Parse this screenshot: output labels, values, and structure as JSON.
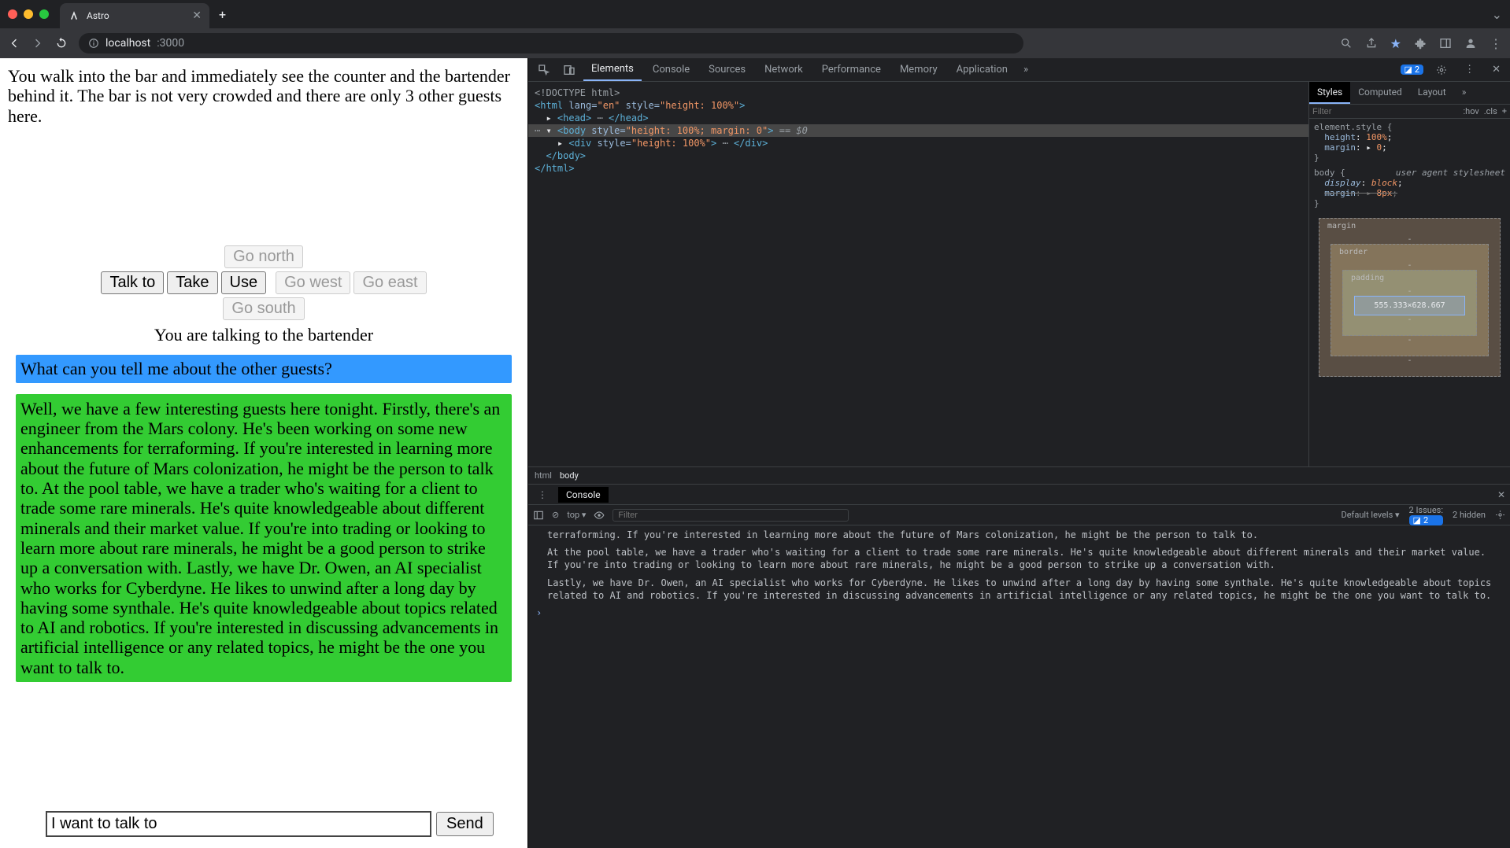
{
  "browser": {
    "tab_title": "Astro",
    "url_host": "localhost",
    "url_port": ":3000"
  },
  "game": {
    "description": "You walk into the bar and immediately see the counter and the bartender behind it. The bar is not very crowded and there are only 3 other guests here.",
    "buttons": {
      "talk": "Talk to",
      "take": "Take",
      "use": "Use",
      "north": "Go north",
      "south": "Go south",
      "east": "Go east",
      "west": "Go west"
    },
    "status": "You are talking to the bartender",
    "user_msg": "What can you tell me about the other guests?",
    "npc_msg": "Well, we have a few interesting guests here tonight. Firstly, there's an engineer from the Mars colony. He's been working on some new enhancements for terraforming. If you're interested in learning more about the future of Mars colonization, he might be the person to talk to. At the pool table, we have a trader who's waiting for a client to trade some rare minerals. He's quite knowledgeable about different minerals and their market value. If you're into trading or looking to learn more about rare minerals, he might be a good person to strike up a conversation with. Lastly, we have Dr. Owen, an AI specialist who works for Cyberdyne. He likes to unwind after a long day by having some synthale. He's quite knowledgeable about topics related to AI and robotics. If you're interested in discussing advancements in artificial intelligence or any related topics, he might be the one you want to talk to.",
    "input_value": "I want to talk to ",
    "send_label": "Send"
  },
  "devtools": {
    "tabs": [
      "Elements",
      "Console",
      "Sources",
      "Network",
      "Performance",
      "Memory",
      "Application"
    ],
    "active_tab": "Elements",
    "issues_count": "2",
    "dom": {
      "l1": "<!DOCTYPE html>",
      "l2a": "<",
      "l2b": "html",
      "l2c": " lang=",
      "l2d": "\"en\"",
      "l2e": " style=",
      "l2f": "\"height: 100%\"",
      "l2g": ">",
      "l3": "<head>",
      "l3b": "</head>",
      "l4a": "<",
      "l4b": "body",
      "l4c": " style=",
      "l4d": "\"height: 100%; margin: 0\"",
      "l4e": ">",
      "l4f": " == $0",
      "l5a": "<",
      "l5b": "div",
      "l5c": " style=",
      "l5d": "\"height: 100%\"",
      "l5e": ">",
      "l5f": "</div>",
      "l6": "</body>",
      "l7": "</html>"
    },
    "styles": {
      "tabs": [
        "Styles",
        "Computed",
        "Layout"
      ],
      "filter_placeholder": "Filter",
      "hov": ":hov",
      "cls": ".cls",
      "rule1_sel": "element.style {",
      "rule1_p1": "height",
      "rule1_v1": "100%",
      "rule1_p2": "margin",
      "rule1_v2": "0",
      "rule2_sel": "body {",
      "rule2_comment": "user agent stylesheet",
      "rule2_p1": "display",
      "rule2_v1": "block",
      "rule2_p2": "margin",
      "rule2_v2": "8px",
      "close": "}",
      "box_margin": "margin",
      "box_border": "border",
      "box_padding": "padding",
      "box_dims": "555.333×628.667",
      "dash": "-"
    },
    "breadcrumb": {
      "html": "html",
      "body": "body"
    },
    "console": {
      "tab": "Console",
      "top": "top ▾",
      "filter_placeholder": "Filter",
      "levels": "Default levels ▾",
      "issues": "2 Issues:",
      "issues_badge": "2",
      "hidden": "2 hidden",
      "lines": [
        "terraforming. If you're interested in learning more about the future of Mars colonization, he might be the person to talk to.",
        "At the pool table, we have a trader who's waiting for a client to trade some rare minerals. He's quite knowledgeable about different minerals and their market value. If you're into trading or looking to learn more about rare minerals, he might be a good person to strike up a conversation with.",
        "Lastly, we have Dr. Owen, an AI specialist who works for Cyberdyne. He likes to unwind after a long day by having some synthale. He's quite knowledgeable about topics related to AI and robotics. If you're interested in discussing advancements in artificial intelligence or any related topics, he might be the one you want to talk to."
      ],
      "prompt": "›"
    }
  }
}
